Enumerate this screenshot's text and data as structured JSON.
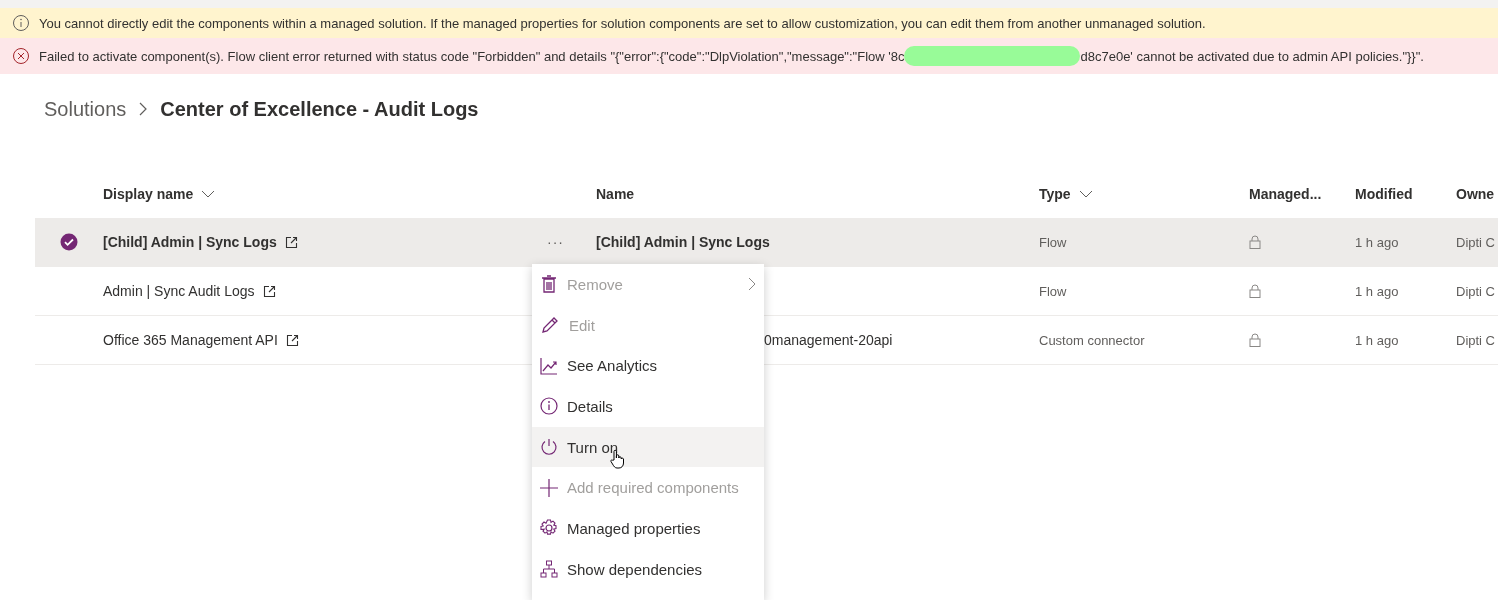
{
  "banners": [
    {
      "kind": "info",
      "text": "You cannot directly edit the components within a managed solution. If the managed properties for solution components are set to allow customization, you can edit them from another unmanaged solution."
    },
    {
      "kind": "error",
      "text": "Failed to activate component(s). Flow client error returned with status code \"Forbidden\" and details \"{\"error\":{\"code\":\"DlpViolation\",\"message\":\"Flow '8c",
      "text_after": "d8c7e0e' cannot be activated due to admin API policies.\"}}\"."
    }
  ],
  "breadcrumb": {
    "parent": "Solutions",
    "current": "Center of Excellence - Audit Logs"
  },
  "columns": [
    {
      "label": "Display name",
      "sortable": true
    },
    {
      "label": "Name",
      "sortable": false
    },
    {
      "label": "Type",
      "sortable": true
    },
    {
      "label": "Managed...",
      "sortable": false
    },
    {
      "label": "Modified",
      "sortable": false
    },
    {
      "label": "Owne",
      "sortable": false
    }
  ],
  "rows": [
    {
      "selected": true,
      "display_name": "[Child] Admin | Sync Logs",
      "name": "[Child] Admin | Sync Logs",
      "type": "Flow",
      "modified": "1 h ago",
      "owner": "Dipti C"
    },
    {
      "selected": false,
      "display_name": "Admin | Sync Audit Logs",
      "type": "Flow",
      "modified": "1 h ago",
      "owner": "Dipti C"
    },
    {
      "selected": false,
      "display_name": "Office 365 Management API",
      "name": "0management-20api",
      "type": "Custom connector",
      "modified": "1 h ago",
      "owner": "Dipti C"
    }
  ],
  "row_actions": {
    "label": "···"
  },
  "context_menu": [
    {
      "label": "Remove",
      "disabled": true,
      "submenu": true,
      "hovered": false
    },
    {
      "label": "Edit",
      "disabled": true,
      "submenu": false,
      "hovered": false
    },
    {
      "label": "See Analytics",
      "disabled": false,
      "submenu": false,
      "hovered": false
    },
    {
      "label": "Details",
      "disabled": false,
      "submenu": false,
      "hovered": false
    },
    {
      "label": "Turn on",
      "disabled": false,
      "submenu": false,
      "hovered": true
    },
    {
      "label": "Add required components",
      "disabled": true,
      "submenu": false,
      "hovered": false
    },
    {
      "label": "Managed properties",
      "disabled": false,
      "submenu": false,
      "hovered": false
    },
    {
      "label": "Show dependencies",
      "disabled": false,
      "submenu": false,
      "hovered": false
    }
  ]
}
